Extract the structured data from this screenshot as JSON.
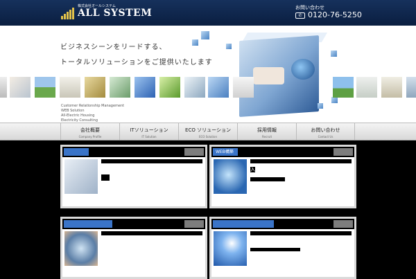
{
  "header": {
    "company_small": "株式会社オールシステム",
    "company_name": "ALL SYSTEM",
    "contact_label": "お問い合わせ",
    "free_dial_icon": "phone-free-dial-icon",
    "phone": "0120-76-5250"
  },
  "hero": {
    "tagline_1": "ビジネスシーンをリードする、",
    "tagline_2": "トータルソリューションをご提供いたします",
    "services": [
      "Customer Relationship Management",
      "WEB Solution",
      "All-Electric Housing",
      "Electricity Consulting"
    ]
  },
  "nav": {
    "items": [
      {
        "label": "会社概要",
        "sub": "Company Profile"
      },
      {
        "label": "ITソリューション",
        "sub": "IT Solution"
      },
      {
        "label": "ECO ソリューション",
        "sub": "ECO Solution"
      },
      {
        "label": "採用情報",
        "sub": "Recruit"
      },
      {
        "label": "お問い合わせ",
        "sub": "Contact Us"
      }
    ]
  },
  "cards": [
    {
      "label": "",
      "text": ""
    },
    {
      "label": "WEB構築",
      "text": "入"
    },
    {
      "label": "",
      "text": ""
    },
    {
      "label": "",
      "text": ""
    }
  ],
  "colors": {
    "header_bg": "#16315c",
    "accent_blue": "#3a74c8",
    "logo_gold": "#e2c24a"
  }
}
